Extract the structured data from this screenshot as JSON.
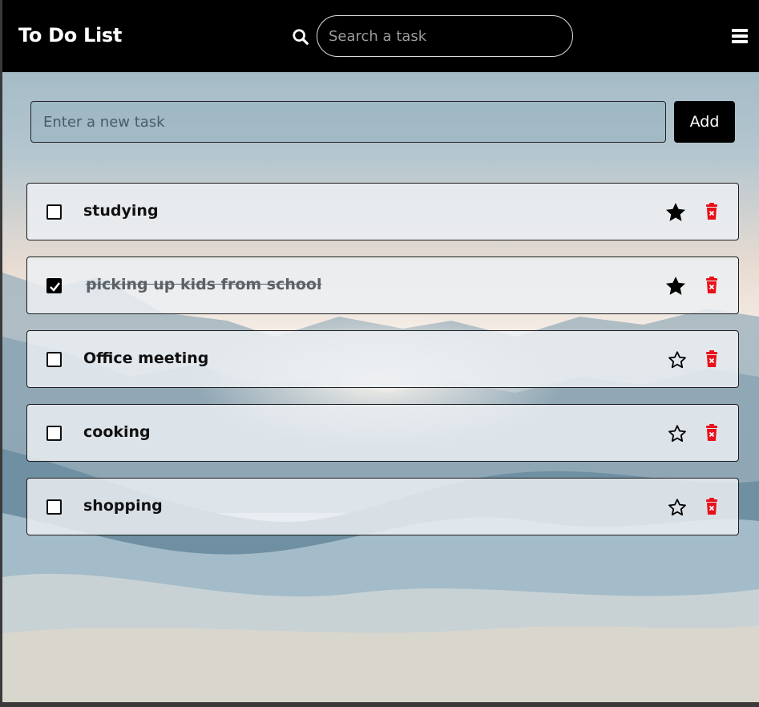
{
  "header": {
    "title": "To Do List",
    "search_placeholder": "Search a task",
    "search_icon": "search-icon",
    "menu_icon": "hamburger-menu-icon"
  },
  "new_task": {
    "placeholder": "Enter a new task",
    "add_label": "Add"
  },
  "tasks": [
    {
      "text": "studying",
      "completed": false,
      "starred": true
    },
    {
      "text": "picking up kids from school",
      "completed": true,
      "starred": true
    },
    {
      "text": "Office meeting",
      "completed": false,
      "starred": false
    },
    {
      "text": "cooking",
      "completed": false,
      "starred": false
    },
    {
      "text": "shopping",
      "completed": false,
      "starred": false
    }
  ],
  "colors": {
    "header_bg": "#000000",
    "delete": "#e8101a",
    "star": "#000000"
  }
}
